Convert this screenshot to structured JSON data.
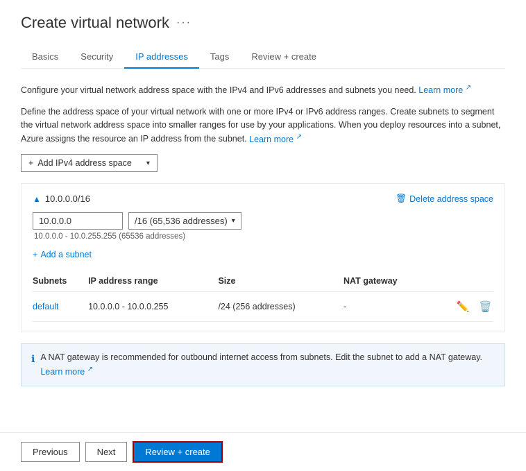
{
  "page": {
    "title": "Create virtual network",
    "ellipsis": "···"
  },
  "tabs": [
    {
      "id": "basics",
      "label": "Basics",
      "active": false
    },
    {
      "id": "security",
      "label": "Security",
      "active": false
    },
    {
      "id": "ip-addresses",
      "label": "IP addresses",
      "active": true
    },
    {
      "id": "tags",
      "label": "Tags",
      "active": false
    },
    {
      "id": "review-create",
      "label": "Review + create",
      "active": false
    }
  ],
  "description1": "Configure your virtual network address space with the IPv4 and IPv6 addresses and subnets you need.",
  "learn_more_1": "Learn more",
  "description2": "Define the address space of your virtual network with one or more IPv4 or IPv6 address ranges. Create subnets to segment the virtual network address space into smaller ranges for use by your applications. When you deploy resources into a subnet, Azure assigns the resource an IP address from the subnet.",
  "learn_more_2": "Learn more",
  "add_ipv4_btn": "Add IPv4 address space",
  "address_space": {
    "cidr": "10.0.0.0/16",
    "ip_value": "10.0.0.0",
    "cidr_label": "/16 (65,536 addresses)",
    "range_hint": "10.0.0.0 - 10.0.255.255 (65536 addresses)",
    "delete_label": "Delete address space",
    "add_subnet_label": "Add a subnet"
  },
  "subnets_table": {
    "headers": [
      "Subnets",
      "IP address range",
      "Size",
      "NAT gateway"
    ],
    "rows": [
      {
        "name": "default",
        "ip_range": "10.0.0.0 - 10.0.0.255",
        "size": "/24 (256 addresses)",
        "nat_gateway": "-"
      }
    ]
  },
  "info_banner": {
    "text": "A NAT gateway is recommended for outbound internet access from subnets. Edit the subnet to add a NAT gateway.",
    "learn_more": "Learn more"
  },
  "nav": {
    "previous": "Previous",
    "next": "Next",
    "review_create": "Review + create"
  }
}
